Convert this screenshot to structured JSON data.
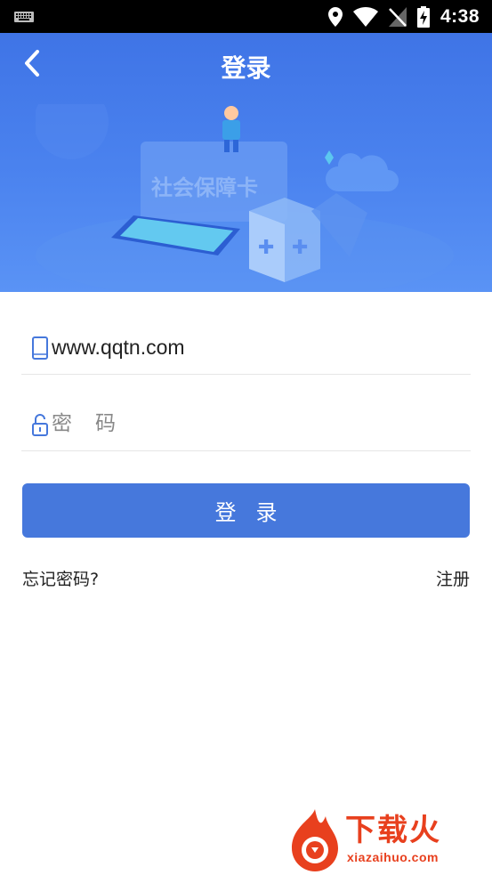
{
  "status_bar": {
    "time": "4:38",
    "icons": [
      "keyboard-icon",
      "location-icon",
      "wifi-icon",
      "no-signal-icon",
      "battery-charging-icon"
    ]
  },
  "header": {
    "title": "登录",
    "back_icon": "chevron-left-icon"
  },
  "banner": {
    "card_text": "社会保障卡"
  },
  "form": {
    "phone_value": "www.qqtn.com",
    "phone_icon": "phone-icon",
    "password_placeholder": "密码",
    "password_icon": "lock-icon",
    "login_label": "登录"
  },
  "links": {
    "forgot": "忘记密码?",
    "register": "注册"
  },
  "watermark": {
    "brand": "下载火",
    "url": "xiazaihuo.com"
  },
  "colors": {
    "primary": "#4678dc",
    "header_bg": "#3f74e6",
    "watermark": "#e8401e"
  }
}
